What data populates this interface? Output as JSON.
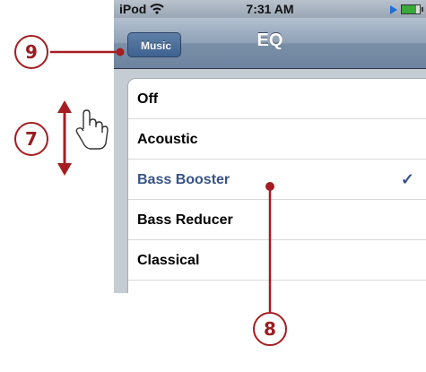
{
  "status_bar": {
    "carrier": "iPod",
    "time": "7:31 AM"
  },
  "nav": {
    "back_label": "Music",
    "title": "EQ"
  },
  "eq_presets": [
    {
      "label": "Off",
      "selected": false
    },
    {
      "label": "Acoustic",
      "selected": false
    },
    {
      "label": "Bass Booster",
      "selected": true
    },
    {
      "label": "Bass Reducer",
      "selected": false
    },
    {
      "label": "Classical",
      "selected": false
    }
  ],
  "selected_mark": "✓",
  "callouts": {
    "back": "9",
    "scroll": "7",
    "select": "8"
  },
  "colors": {
    "callout": "#a51d22",
    "nav_bar": "#7a8fa7",
    "selected_text": "#385487"
  },
  "icons": {
    "hand": "hand-pointer-icon",
    "scroll_arrow": "double-arrow-icon"
  }
}
